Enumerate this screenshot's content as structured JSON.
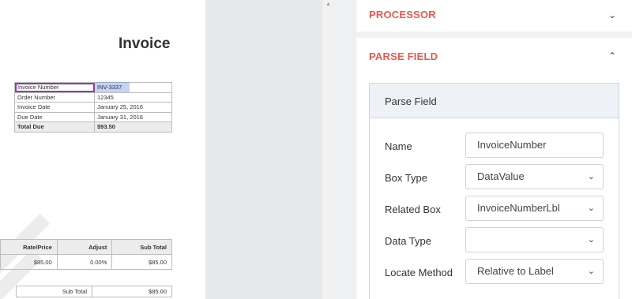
{
  "document": {
    "title": "Invoice",
    "meta_rows": [
      {
        "label": "Invoice Number",
        "value": "INV-3337"
      },
      {
        "label": "Order Number",
        "value": "12345"
      },
      {
        "label": "Invoice Date",
        "value": "January 25, 2016"
      },
      {
        "label": "Due Date",
        "value": "January 31, 2016"
      },
      {
        "label": "Total Due",
        "value": "$93.50"
      }
    ],
    "items_header": [
      "Rate/Price",
      "Adjust",
      "Sub Total"
    ],
    "items_row": [
      "$85.00",
      "0.00%",
      "$85.00"
    ],
    "subtotal": {
      "label": "Sub Total",
      "value": "$85.00"
    }
  },
  "panel": {
    "processor_title": "PROCESSOR",
    "parse_title": "PARSE FIELD",
    "card_title": "Parse Field",
    "fields": {
      "name": {
        "label": "Name",
        "value": "InvoiceNumber"
      },
      "box_type": {
        "label": "Box Type",
        "value": "DataValue"
      },
      "related_box": {
        "label": "Related Box",
        "value": "InvoiceNumberLbl"
      },
      "data_type": {
        "label": "Data Type",
        "value": ""
      },
      "locate_method": {
        "label": "Locate Method",
        "value": "Relative to Label"
      }
    }
  },
  "icons": {
    "chevron_down": "chevron-down-icon",
    "chevron_up": "chevron-up-icon",
    "scroll_up": "scroll-up-arrow-icon"
  },
  "colors": {
    "section_title": "#e8594e",
    "highlight_label": "#8e3bb0",
    "highlight_value": "#5a82dc"
  }
}
